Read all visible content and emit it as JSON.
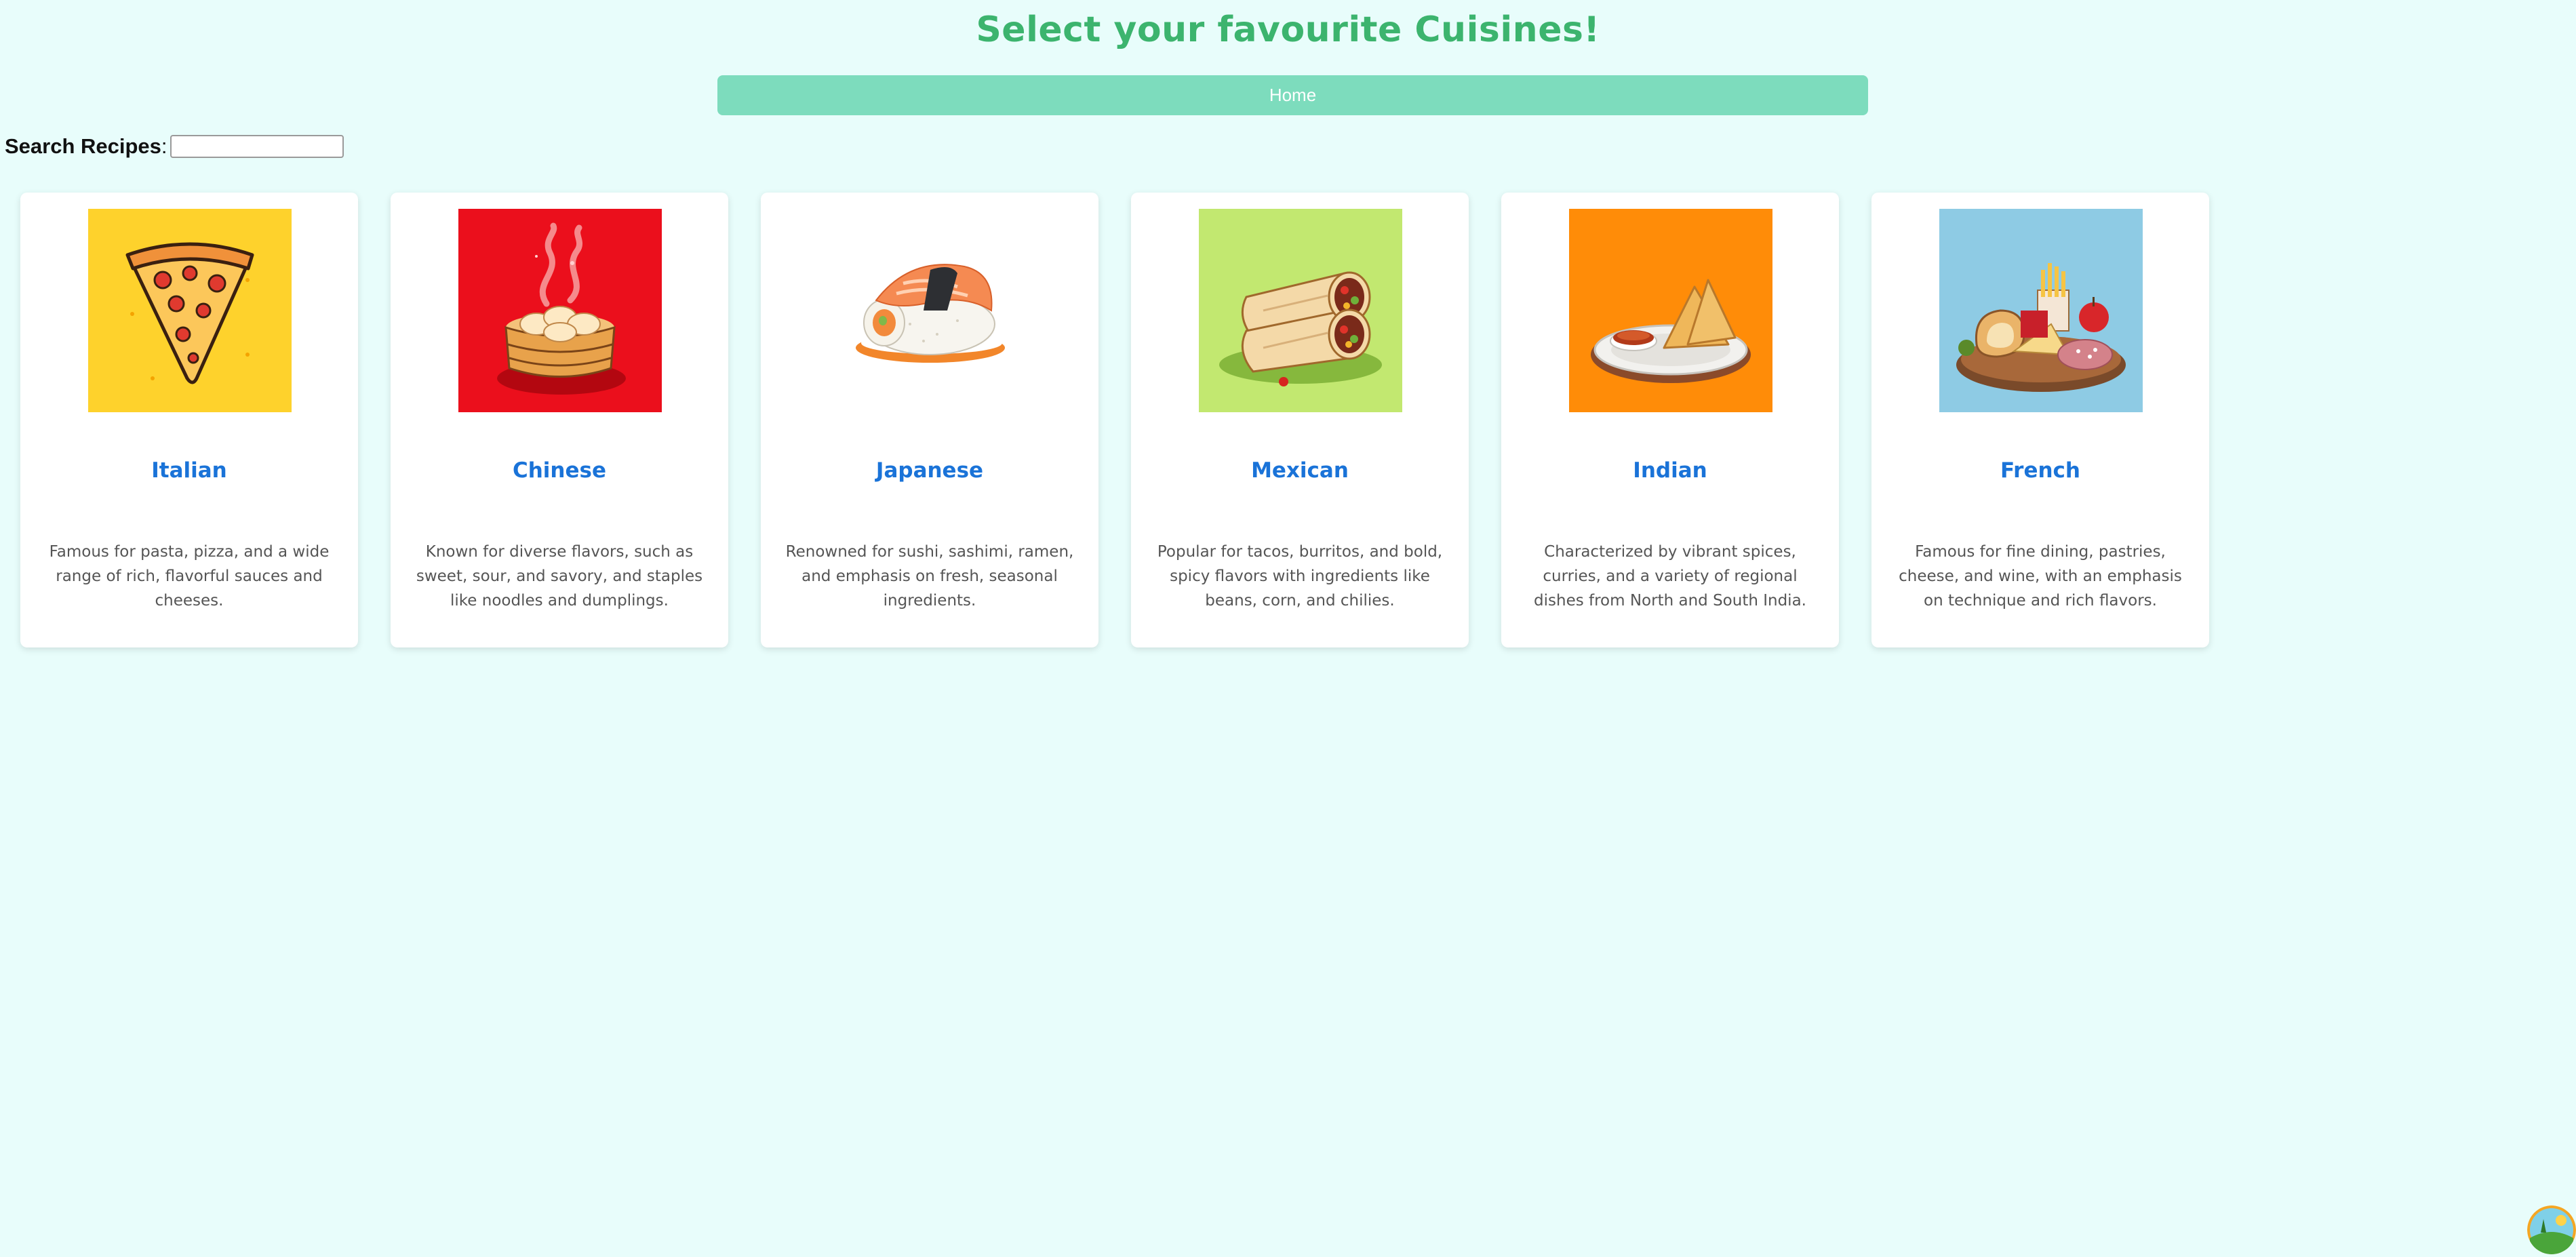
{
  "header": {
    "title": "Select your favourite Cuisines!"
  },
  "nav": {
    "home_label": "Home"
  },
  "search": {
    "label": "Search Recipes",
    "colon": ":",
    "value": "",
    "placeholder": ""
  },
  "cards": [
    {
      "title": "Italian",
      "description": "Famous for pasta, pizza, and a wide range of rich, flavorful sauces and cheeses.",
      "image": "pizza-slice-illustration",
      "bg_color": "#fed22c"
    },
    {
      "title": "Chinese",
      "description": "Known for diverse flavors, such as sweet, sour, and savory, and staples like noodles and dumplings.",
      "image": "dumpling-steamer-illustration",
      "bg_color": "#eb0f1c"
    },
    {
      "title": "Japanese",
      "description": "Renowned for sushi, sashimi, ramen, and emphasis on fresh, seasonal ingredients.",
      "image": "sushi-illustration",
      "bg_color": "#ffffff"
    },
    {
      "title": "Mexican",
      "description": "Popular for tacos, burritos, and bold, spicy flavors with ingredients like beans, corn, and chilies.",
      "image": "burrito-illustration",
      "bg_color": "#c2e870"
    },
    {
      "title": "Indian",
      "description": "Characterized by vibrant spices, curries, and a variety of regional dishes from North and South India.",
      "image": "samosa-plate-illustration",
      "bg_color": "#ff8c08"
    },
    {
      "title": "French",
      "description": "Famous for fine dining, pastries, cheese, and wine, with an emphasis on technique and rich flavors.",
      "image": "french-platter-illustration",
      "bg_color": "#8ecbe4"
    }
  ],
  "colors": {
    "page_bg": "#e8fdfb",
    "title": "#3cb46e",
    "nav_bg": "#7ddcbd",
    "card_title": "#1a73d8",
    "card_text": "#555555"
  }
}
